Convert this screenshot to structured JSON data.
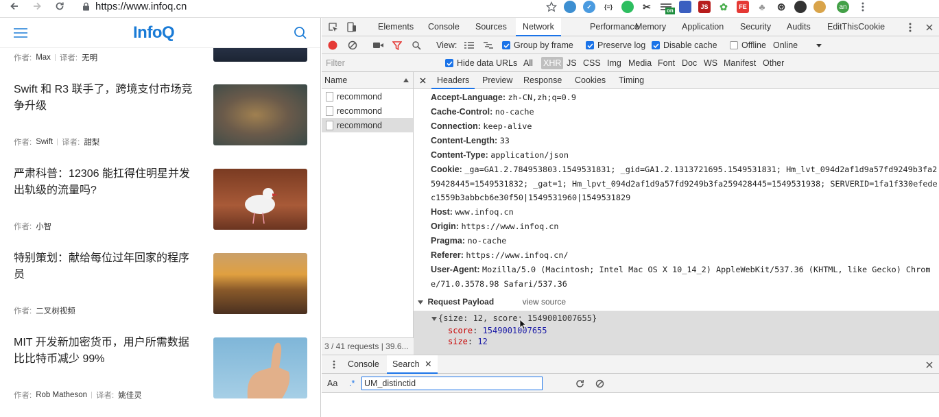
{
  "browser": {
    "url": "https://www.infoq.cn",
    "ext_on_badge": "on",
    "ext_js_badge": "JS",
    "ext_fe_badge": "FE",
    "ext_json_badge": "{≡}",
    "avatar_initials": "an"
  },
  "page": {
    "logo": "InfoQ",
    "articles": [
      {
        "title": "",
        "meta": [
          {
            "label": "作者:",
            "value": "Max"
          },
          {
            "label": "译者:",
            "value": "无明"
          }
        ]
      },
      {
        "title": "Swift 和 R3 联手了，跨境支付市场竞争升级",
        "meta": [
          {
            "label": "作者:",
            "value": "Swift"
          },
          {
            "label": "译者:",
            "value": "甜梨"
          }
        ]
      },
      {
        "title": "严肃科普：12306 能扛得住明星并发出轨级的流量吗?",
        "meta": [
          {
            "label": "作者:",
            "value": "小智"
          }
        ]
      },
      {
        "title": "特别策划：献给每位过年回家的程序员",
        "meta": [
          {
            "label": "作者:",
            "value": "二叉树视频"
          }
        ]
      },
      {
        "title": "MIT 开发新加密货币，用户所需数据比比特币减少 99%",
        "meta": [
          {
            "label": "作者:",
            "value": "Rob Matheson"
          },
          {
            "label": "译者:",
            "value": "姚佳灵"
          }
        ]
      }
    ]
  },
  "devtools": {
    "tabs": [
      "Elements",
      "Console",
      "Sources",
      "Network",
      "Performance",
      "Memory",
      "Application",
      "Security",
      "Audits",
      "EditThisCookie"
    ],
    "active_tab": "Network",
    "toolbar": {
      "view_label": "View:",
      "group_by_frame": "Group by frame",
      "preserve_log": "Preserve log",
      "disable_cache": "Disable cache",
      "offline": "Offline",
      "throttle": "Online"
    },
    "filter": {
      "placeholder": "Filter",
      "hide_data_urls": "Hide data URLs",
      "types": [
        "All",
        "XHR",
        "JS",
        "CSS",
        "Img",
        "Media",
        "Font",
        "Doc",
        "WS",
        "Manifest",
        "Other"
      ],
      "active_type": "XHR"
    },
    "requests": {
      "column": "Name",
      "items": [
        "recommond",
        "recommond",
        "recommond"
      ],
      "footer": "3 / 41 requests | 39.6..."
    },
    "details": {
      "tabs": [
        "Headers",
        "Preview",
        "Response",
        "Cookies",
        "Timing"
      ],
      "headers": [
        {
          "key": "Accept-Language:",
          "value": "zh-CN,zh;q=0.9"
        },
        {
          "key": "Cache-Control:",
          "value": "no-cache"
        },
        {
          "key": "Connection:",
          "value": "keep-alive"
        },
        {
          "key": "Content-Length:",
          "value": "33"
        },
        {
          "key": "Content-Type:",
          "value": "application/json"
        },
        {
          "key": "Cookie:",
          "value": "_ga=GA1.2.784953803.1549531831; _gid=GA1.2.1313721695.1549531831; Hm_lvt_094d2af1d9a57fd9249b3fa259428445=1549531832; _gat=1; Hm_lpvt_094d2af1d9a57fd9249b3fa259428445=1549531938; SERVERID=1fa1f330efedec1559b3abbcb6e30f50|1549531960|1549531829"
        },
        {
          "key": "Host:",
          "value": "www.infoq.cn"
        },
        {
          "key": "Origin:",
          "value": "https://www.infoq.cn"
        },
        {
          "key": "Pragma:",
          "value": "no-cache"
        },
        {
          "key": "Referer:",
          "value": "https://www.infoq.cn/"
        },
        {
          "key": "User-Agent:",
          "value": "Mozilla/5.0 (Macintosh; Intel Mac OS X 10_14_2) AppleWebKit/537.36 (KHTML, like Gecko) Chrome/71.0.3578.98 Safari/537.36"
        }
      ],
      "payload_title": "Request Payload",
      "view_source": "view source",
      "payload_summary": "{size: 12, score: 1549001007655}",
      "payload_fields": [
        {
          "key": "score",
          "value": "1549001007655"
        },
        {
          "key": "size",
          "value": "12"
        }
      ]
    },
    "drawer": {
      "tabs": [
        "Console",
        "Search"
      ],
      "active": "Search",
      "case_label": "Aa",
      "regex_label": ".*",
      "search_value": "UM_distinctid"
    }
  },
  "colors": {
    "accent": "#1a73e8",
    "logo": "#1a7bd6",
    "record": "#e53935",
    "payload_key": "#c80000",
    "payload_value": "#1a1aa6"
  }
}
